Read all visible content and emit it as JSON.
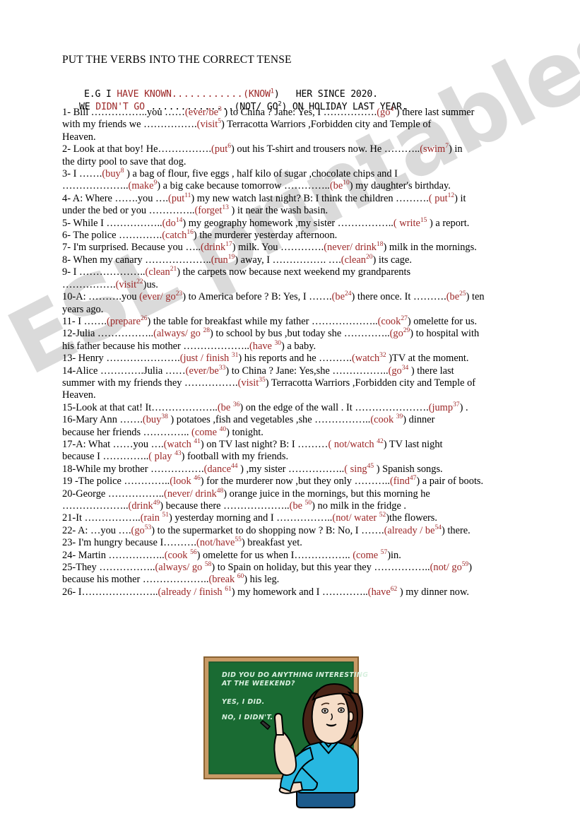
{
  "worksheet": {
    "title": "PUT THE VERBS INTO THE CORRECT TENSE",
    "example": {
      "line1_pre": "E.G I ",
      "line1_answer": "HAVE KNOWN",
      "line1_dots": "............",
      "line1_cue": "(KNOW",
      "line1_cue_num": "1",
      "line1_post": ")   HER SINCE 2020.",
      "line2_pre": "WE ",
      "line2_answer": "DIDN'T GO",
      "line2_dots": " ..............",
      "line2_cue": "(NOT/ GO",
      "line2_cue_num": "2",
      "line2_post": ") ON HOLIDAY LAST YEAR."
    }
  },
  "watermark": {
    "text": "ESL printables.com"
  },
  "items": [
    {
      "number": "1-",
      "lines": [
        [
          {
            "t": "text",
            "v": " Bill ……………..you ……"
          },
          {
            "t": "cue",
            "v": "(ever/be",
            "n": "3"
          },
          {
            "t": "text",
            "v": " ) to China ? Jane: Yes, I ……………."
          },
          {
            "t": "cue",
            "v": "(go",
            "n": "4"
          },
          {
            "t": "text",
            "v": " ) there last summer"
          }
        ],
        [
          {
            "t": "text",
            "v": "with my friends we ……………."
          },
          {
            "t": "cue",
            "v": "(visit",
            "n": "5"
          },
          {
            "t": "text",
            "v": ") Terracotta Warriors ,Forbidden city and Temple of"
          }
        ],
        [
          {
            "t": "text",
            "v": "Heaven."
          }
        ]
      ]
    },
    {
      "number": "2-",
      "lines": [
        [
          {
            "t": "text",
            "v": " Look at that boy! He……………."
          },
          {
            "t": "cue",
            "v": "(put",
            "n": "6"
          },
          {
            "t": "text",
            "v": ") out his T-shirt and trousers now. He ……….."
          },
          {
            "t": "cue",
            "v": "(swim",
            "n": "7"
          },
          {
            "t": "text",
            "v": ") in"
          }
        ],
        [
          {
            "t": "text",
            "v": "the dirty pool to save that dog."
          }
        ]
      ]
    },
    {
      "number": "3-",
      "lines": [
        [
          {
            "t": "text",
            "v": " I ……."
          },
          {
            "t": "cue",
            "v": "(buy",
            "n": "8"
          },
          {
            "t": "text",
            "v": " ) a bag of flour, five eggs , half kilo of sugar ,chocolate chips and I"
          }
        ],
        [
          {
            "t": "text",
            "v": "……………….."
          },
          {
            "t": "cue",
            "v": "(make",
            "n": "9"
          },
          {
            "t": "text",
            "v": ") a big  cake because tomorrow ………….."
          },
          {
            "t": "cue",
            "v": "(be",
            "n": "10"
          },
          {
            "t": "text",
            "v": ") my daughter's birthday."
          }
        ]
      ]
    },
    {
      "number": "4-",
      "lines": [
        [
          {
            "t": "text",
            "v": " A: Where …….you …."
          },
          {
            "t": "cue",
            "v": "(put",
            "n": "11"
          },
          {
            "t": "text",
            "v": ") my new watch last night? B: I think the children ………."
          },
          {
            "t": "cue",
            "v": "( put",
            "n": "12"
          },
          {
            "t": "text",
            "v": ") it"
          }
        ],
        [
          {
            "t": "text",
            "v": "under the bed or you ………….."
          },
          {
            "t": "cue",
            "v": "(forget",
            "n": "13"
          },
          {
            "t": "text",
            "v": " ) it near the wash basin."
          }
        ]
      ]
    },
    {
      "number": "5-",
      "lines": [
        [
          {
            "t": "text",
            "v": " While I …………….."
          },
          {
            "t": "cue",
            "v": "(do",
            "n": "14"
          },
          {
            "t": "text",
            "v": ") my geography  homework ,my sister …………….."
          },
          {
            "t": "cue",
            "v": "( write",
            "n": "15"
          },
          {
            "t": "text",
            "v": " ) a report."
          }
        ]
      ]
    },
    {
      "number": "6-",
      "lines": [
        [
          {
            "t": "text",
            "v": " The police …………."
          },
          {
            "t": "cue",
            "v": "(catch",
            "n": "16"
          },
          {
            "t": "text",
            "v": ") the murderer yesterday afternoon."
          }
        ]
      ]
    },
    {
      "number": "7-",
      "lines": [
        [
          {
            "t": "text",
            "v": " I'm surprised. Because you ….."
          },
          {
            "t": "cue",
            "v": "(drink",
            "n": "17"
          },
          {
            "t": "text",
            "v": ") milk. You …………."
          },
          {
            "t": "cue",
            "v": "(never/ drink",
            "n": "18"
          },
          {
            "t": "text",
            "v": ") milk in the mornings."
          }
        ]
      ]
    },
    {
      "number": "8-",
      "lines": [
        [
          {
            "t": "text",
            "v": " When my canary ……………….."
          },
          {
            "t": "cue",
            "v": "(run",
            "n": "19"
          },
          {
            "t": "text",
            "v": ") away, I ……………. …."
          },
          {
            "t": "cue",
            "v": "(clean",
            "n": "20"
          },
          {
            "t": "text",
            "v": ") its cage."
          }
        ]
      ]
    },
    {
      "number": "9-",
      "lines": [
        [
          {
            "t": "text",
            "v": " I ……………….."
          },
          {
            "t": "cue",
            "v": "(clean",
            "n": "21"
          },
          {
            "t": "text",
            "v": ") the carpets now because next weekend my grandparents"
          }
        ],
        [
          {
            "t": "text",
            "v": "……………."
          },
          {
            "t": "cue",
            "v": "(visit",
            "n": "22"
          },
          {
            "t": "text",
            "v": ")us."
          }
        ]
      ]
    },
    {
      "number": "10-",
      "lines": [
        [
          {
            "t": "text",
            "v": "A: ……….you "
          },
          {
            "t": "cue",
            "v": "(ever/ go",
            "n": "23"
          },
          {
            "t": "text",
            "v": ") to America before ? B: Yes, I ……."
          },
          {
            "t": "cue",
            "v": "(be",
            "n": "24"
          },
          {
            "t": "text",
            "v": ") there once. It ………."
          },
          {
            "t": "cue",
            "v": "(be",
            "n": "25"
          },
          {
            "t": "text",
            "v": ") ten"
          }
        ],
        [
          {
            "t": "text",
            "v": "years ago."
          }
        ]
      ]
    },
    {
      "number": "11-",
      "lines": [
        [
          {
            "t": "text",
            "v": " I ……."
          },
          {
            "t": "cue",
            "v": "(prepare",
            "n": "26"
          },
          {
            "t": "text",
            "v": ") the table for breakfast while my father ……………….."
          },
          {
            "t": "cue",
            "v": "(cook",
            "n": "27"
          },
          {
            "t": "text",
            "v": ") omelette for us."
          }
        ]
      ]
    },
    {
      "number": "12-",
      "lines": [
        [
          {
            "t": "text",
            "v": "Julia …………….."
          },
          {
            "t": "cue",
            "v": "(always/ go ",
            "n": "28"
          },
          {
            "t": "text",
            "v": ") to school by bus ,but today she ………….."
          },
          {
            "t": "cue",
            "v": "(go",
            "n": "29"
          },
          {
            "t": "text",
            "v": ") to hospital with"
          }
        ],
        [
          {
            "t": "text",
            "v": "his father because his mother ……………….."
          },
          {
            "t": "cue",
            "v": "(have ",
            "n": "30"
          },
          {
            "t": "text",
            "v": ") a baby."
          }
        ]
      ]
    },
    {
      "number": "13-",
      "lines": [
        [
          {
            "t": "text",
            "v": " Henry …………………."
          },
          {
            "t": "cue",
            "v": "(just / finish ",
            "n": "31"
          },
          {
            "t": "text",
            "v": ") his reports and he ………."
          },
          {
            "t": "cue",
            "v": "(watch",
            "n": "32"
          },
          {
            "t": "text",
            "v": " )TV at the moment."
          }
        ]
      ]
    },
    {
      "number": "14-",
      "lines": [
        [
          {
            "t": "text",
            "v": "Alice ………….Julia ……"
          },
          {
            "t": "cue",
            "v": "(ever/be",
            "n": "33"
          },
          {
            "t": "text",
            "v": ") to China ? Jane: Yes,she …………….."
          },
          {
            "t": "cue",
            "v": "(go",
            "n": "34"
          },
          {
            "t": "text",
            "v": " ) there last"
          }
        ],
        [
          {
            "t": "text",
            "v": "summer with my friends they  ……………."
          },
          {
            "t": "cue",
            "v": "(visit",
            "n": "35"
          },
          {
            "t": "text",
            "v": ") Terracotta Warriors ,Forbidden city and Temple of"
          }
        ],
        [
          {
            "t": "text",
            "v": "Heaven."
          }
        ]
      ]
    },
    {
      "number": "15-",
      "lines": [
        [
          {
            "t": "text",
            "v": "Look at that cat! It……………….."
          },
          {
            "t": "cue",
            "v": "(be ",
            "n": "36"
          },
          {
            "t": "text",
            "v": ") on the edge of the wall . It …………………."
          },
          {
            "t": "cue",
            "v": "(jump",
            "n": "37"
          },
          {
            "t": "text",
            "v": ") ."
          }
        ]
      ]
    },
    {
      "number": "16-",
      "lines": [
        [
          {
            "t": "text",
            "v": "Mary Ann  ……."
          },
          {
            "t": "cue",
            "v": "(buy",
            "n": "38"
          },
          {
            "t": "text",
            "v": " ) potatoes ,fish and vegetables ,she …………….."
          },
          {
            "t": "cue",
            "v": "(cook ",
            "n": "39"
          },
          {
            "t": "text",
            "v": ") dinner"
          }
        ],
        [
          {
            "t": "text",
            "v": "because her friends  ………….. "
          },
          {
            "t": "cue",
            "v": "(come ",
            "n": "40"
          },
          {
            "t": "text",
            "v": ") tonight."
          }
        ]
      ]
    },
    {
      "number": "17-",
      "lines": [
        [
          {
            "t": "text",
            "v": "A: What  ……you …."
          },
          {
            "t": "cue",
            "v": "(watch ",
            "n": "41"
          },
          {
            "t": "text",
            "v": ") on TV  last night? B: I ………"
          },
          {
            "t": "cue",
            "v": "( not/watch ",
            "n": "42"
          },
          {
            "t": "text",
            "v": ") TV last night"
          }
        ],
        [
          {
            "t": "text",
            "v": "because I  ………….."
          },
          {
            "t": "cue",
            "v": "( play ",
            "n": "43"
          },
          {
            "t": "text",
            "v": ") football with my friends."
          }
        ]
      ]
    },
    {
      "number": "18-",
      "lines": [
        [
          {
            "t": "text",
            "v": "While my brother  ……………."
          },
          {
            "t": "cue",
            "v": "(dance",
            "n": "44"
          },
          {
            "t": "text",
            "v": " ) ,my sister …………….."
          },
          {
            "t": "cue",
            "v": "( sing",
            "n": "45"
          },
          {
            "t": "text",
            "v": " ) Spanish songs."
          }
        ]
      ]
    },
    {
      "number": "19 -",
      "lines": [
        [
          {
            "t": "text",
            "v": "The police ………….."
          },
          {
            "t": "cue",
            "v": "(look ",
            "n": "46"
          },
          {
            "t": "text",
            "v": ") for the murderer now ,but they only ……….."
          },
          {
            "t": "cue",
            "v": "(find",
            "n": "47"
          },
          {
            "t": "text",
            "v": ") a pair of boots."
          }
        ]
      ]
    },
    {
      "number": "20-",
      "lines": [
        [
          {
            "t": "text",
            "v": "George …………….."
          },
          {
            "t": "cue",
            "v": "(never/ drink",
            "n": "48"
          },
          {
            "t": "text",
            "v": ") orange juice  in the mornings, but this morning he"
          }
        ],
        [
          {
            "t": "text",
            "v": "……………….."
          },
          {
            "t": "cue",
            "v": "(drink",
            "n": "49"
          },
          {
            "t": "text",
            "v": ") because there  ……………….."
          },
          {
            "t": "cue",
            "v": "(be ",
            "n": "50"
          },
          {
            "t": "text",
            "v": ") no milk in the fridge ."
          }
        ]
      ]
    },
    {
      "number": "21-",
      "lines": [
        [
          {
            "t": "text",
            "v": "It  …………….."
          },
          {
            "t": "cue",
            "v": "(rain ",
            "n": "51"
          },
          {
            "t": "text",
            "v": ") yesterday morning and I  …………….."
          },
          {
            "t": "cue",
            "v": "(not/ water ",
            "n": "52"
          },
          {
            "t": "text",
            "v": ")the flowers."
          }
        ]
      ]
    },
    {
      "number": "22-",
      "lines": [
        [
          {
            "t": "text",
            "v": " A: …you …."
          },
          {
            "t": "cue",
            "v": "(go",
            "n": "53"
          },
          {
            "t": "text",
            "v": ") to the supermarket to do shopping now ? B: No, I  ……."
          },
          {
            "t": "cue",
            "v": "(already / be",
            "n": "54"
          },
          {
            "t": "text",
            "v": ") there."
          }
        ]
      ]
    },
    {
      "number": "23-",
      "lines": [
        [
          {
            "t": "text",
            "v": "  I'm hungry because I………."
          },
          {
            "t": "cue",
            "v": "(not/have",
            "n": "55"
          },
          {
            "t": "text",
            "v": ") breakfast yet."
          }
        ]
      ]
    },
    {
      "number": "24-",
      "lines": [
        [
          {
            "t": "text",
            "v": " Martin  …………….."
          },
          {
            "t": "cue",
            "v": "(cook ",
            "n": "56"
          },
          {
            "t": "text",
            "v": ") omelette for us when I…………….. "
          },
          {
            "t": "cue",
            "v": "(come ",
            "n": "57"
          },
          {
            "t": "text",
            "v": ")in."
          }
        ]
      ]
    },
    {
      "number": "25-",
      "lines": [
        [
          {
            "t": "text",
            "v": "They …………….."
          },
          {
            "t": "cue",
            "v": "(always/ go ",
            "n": "58"
          },
          {
            "t": "text",
            "v": ") to Spain on holiday, but this year they  …………….."
          },
          {
            "t": "cue",
            "v": "(not/ go",
            "n": "59"
          },
          {
            "t": "text",
            "v": ")"
          }
        ],
        [
          {
            "t": "text",
            "v": "because his mother ……………….."
          },
          {
            "t": "cue",
            "v": "(break ",
            "n": "60"
          },
          {
            "t": "text",
            "v": ") his leg."
          }
        ]
      ]
    },
    {
      "number": "26-",
      "lines": [
        [
          {
            "t": "text",
            "v": " I………………….."
          },
          {
            "t": "cue",
            "v": "(already / finish ",
            "n": "61"
          },
          {
            "t": "text",
            "v": ") my homework and I ………….."
          },
          {
            "t": "cue",
            "v": "(have",
            "n": "62"
          },
          {
            "t": "text",
            "v": " ) my dinner now."
          }
        ]
      ]
    }
  ],
  "illustration": {
    "board_lines": [
      "DID YOU DO ANYTHING INTERESTING",
      "AT THE WEEKEND?",
      "YES, I DID.",
      "NO, I DIDN'T."
    ],
    "colors": {
      "board": "#1a6b33",
      "frame": "#c89a66",
      "shirt": "#27b7e0",
      "skirt": "#1d5b8c",
      "hair": "#4a2417",
      "skin": "#f6ddc8",
      "chalk_text": "#d8f0df"
    }
  }
}
